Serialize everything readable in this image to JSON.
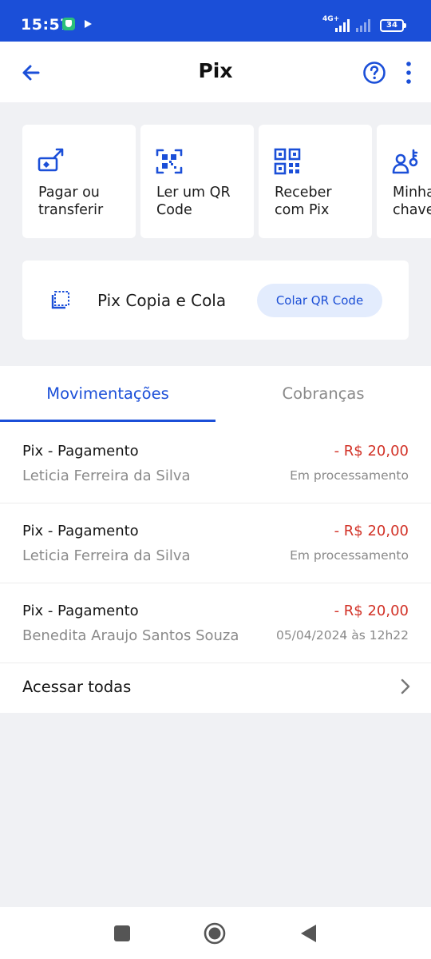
{
  "status_bar": {
    "time": "15:57",
    "network": "4G+",
    "battery": "34"
  },
  "header": {
    "title": "Pix"
  },
  "actions": [
    {
      "label": "Pagar ou\ntransferir",
      "icon": "pay-transfer-icon"
    },
    {
      "label": "Ler um QR\nCode",
      "icon": "qr-scan-icon"
    },
    {
      "label": "Receber\ncom Pix",
      "icon": "qr-code-icon"
    },
    {
      "label": "Minhas\nchaves",
      "icon": "keys-icon"
    }
  ],
  "copia_cola": {
    "label": "Pix Copia e Cola",
    "button": "Colar QR Code",
    "icon": "paste-icon"
  },
  "tabs": [
    {
      "label": "Movimentações",
      "active": true
    },
    {
      "label": "Cobranças",
      "active": false
    }
  ],
  "transactions": [
    {
      "title": "Pix - Pagamento",
      "name": "Leticia Ferreira da Silva",
      "amount": "- R$ 20,00",
      "status": "Em processamento"
    },
    {
      "title": "Pix - Pagamento",
      "name": "Leticia Ferreira da Silva",
      "amount": "- R$ 20,00",
      "status": "Em processamento"
    },
    {
      "title": "Pix - Pagamento",
      "name": "Benedita Araujo Santos Souza",
      "amount": "- R$ 20,00",
      "status": "05/04/2024 às 12h22"
    }
  ],
  "view_all": {
    "label": "Acessar todas"
  },
  "colors": {
    "primary": "#1b4fd8",
    "negative_amount": "#d23227",
    "pill_bg": "#e3ecfd"
  }
}
